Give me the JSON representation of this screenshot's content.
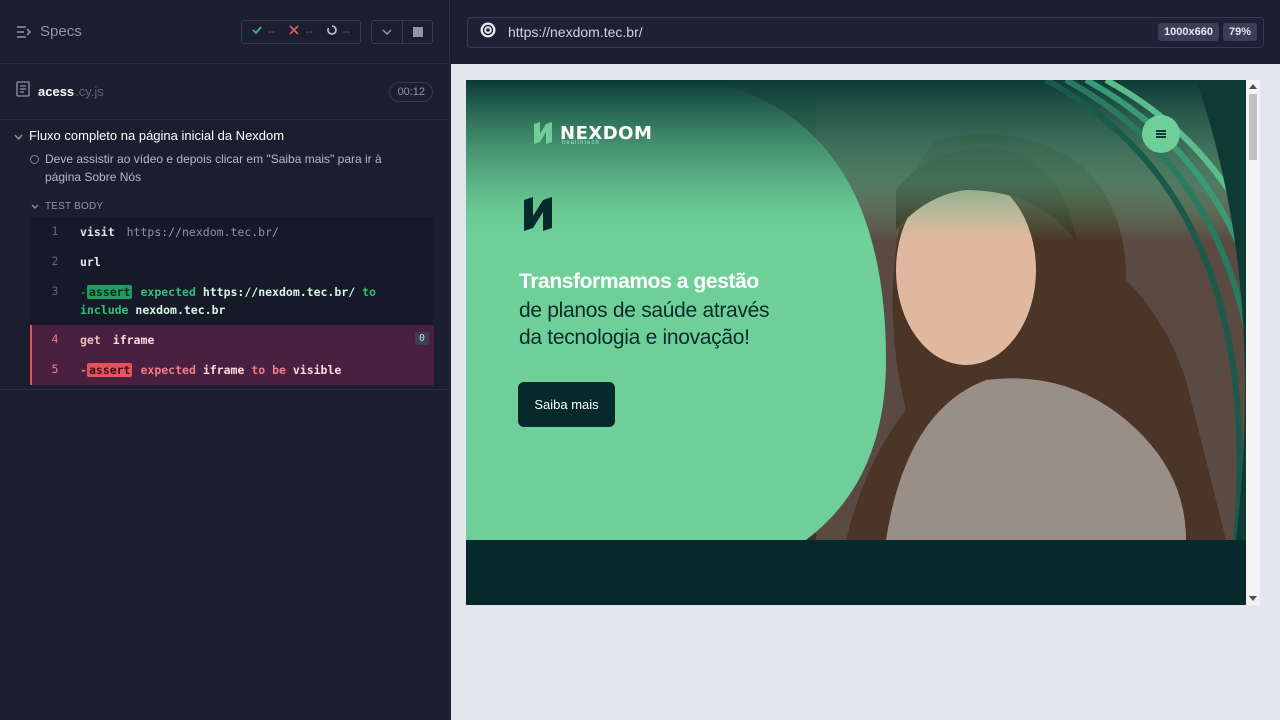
{
  "header": {
    "specs_label": "Specs"
  },
  "stats": {
    "passed": "--",
    "failed": "--",
    "pending": "--"
  },
  "spec": {
    "name": "acess",
    "ext": ".cy.js",
    "duration": "00:12"
  },
  "suite": {
    "title": "Fluxo completo na página inicial da Nexdom"
  },
  "test": {
    "title": "Deve assistir ao vídeo e depois clicar em \"Saiba mais\" para ir à página Sobre Nós"
  },
  "test_body": {
    "label": "TEST BODY"
  },
  "commands": [
    {
      "num": "1",
      "name": "visit",
      "msg": "https://nexdom.tec.br/"
    },
    {
      "num": "2",
      "name": "url",
      "msg": ""
    },
    {
      "num": "3",
      "dash": "-",
      "pill": "assert",
      "expected": "expected",
      "value": "https://nexdom.tec.br/",
      "to": "to",
      "include": "include",
      "value2": "nexdom.tec.br"
    },
    {
      "num": "4",
      "name": "get",
      "msg": "iframe",
      "badge": "0"
    },
    {
      "num": "5",
      "dash": "-",
      "pill": "assert",
      "expected": "expected",
      "value": "iframe",
      "to_be": "to be",
      "value2": "visible"
    }
  ],
  "browser": {
    "url": "https://nexdom.tec.br/",
    "viewport": "1000x660",
    "zoom": "79%"
  },
  "site": {
    "logo": "NEXDOM",
    "logo_sub": "healthtech",
    "headline": "Transformamos a gestão",
    "subline_1": "de planos de saúde através",
    "subline_2": "da tecnologia e inovação!",
    "cta": "Saiba mais"
  },
  "colors": {
    "brand_green": "#6fcf98",
    "brand_dark": "#062a2c",
    "fail": "#e3545f",
    "pass": "#1f9c5e"
  }
}
